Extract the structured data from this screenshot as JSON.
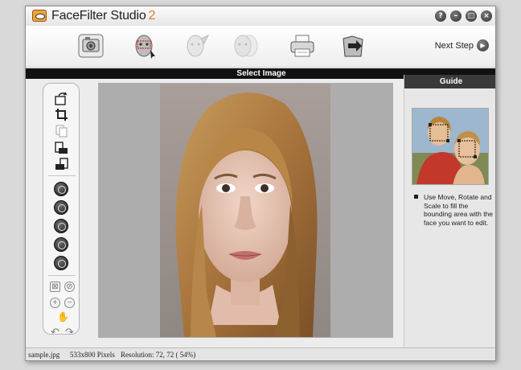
{
  "app": {
    "title": "FaceFilter Studio",
    "version": "2",
    "window_buttons": [
      "?",
      "–",
      "□",
      "×"
    ]
  },
  "toolbar": {
    "items": [
      {
        "name": "select-image",
        "icon": "camera-icon"
      },
      {
        "name": "face-detection",
        "icon": "face-target-icon"
      },
      {
        "name": "face-edit",
        "icon": "face-brush-icon"
      },
      {
        "name": "face-compare",
        "icon": "face-compare-icon"
      },
      {
        "name": "print",
        "icon": "printer-icon"
      },
      {
        "name": "save",
        "icon": "folder-arrow-icon"
      }
    ],
    "next_step_label": "Next Step"
  },
  "section": {
    "title": "Select Image"
  },
  "guide": {
    "header": "Guide",
    "text": "Use Move, Rotate and Scale to fill the bounding area with the face you want to edit."
  },
  "status": {
    "filename": "sample.jpg",
    "dimensions": "533x800 Pixels",
    "resolution": "Resolution: 72, 72 ( 54%)"
  },
  "colors": {
    "accent_orange": "#e07a1f",
    "section_bar": "#111111",
    "guide_header": "#3a3a3a",
    "canvas_bg": "#adadad"
  }
}
